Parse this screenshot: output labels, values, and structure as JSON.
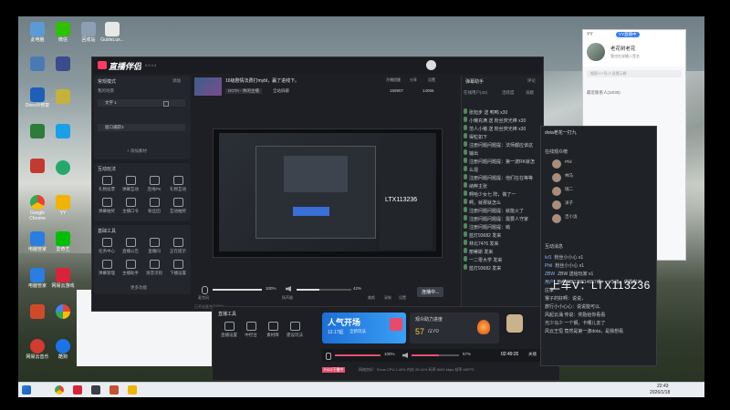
{
  "desktop": {
    "icons_left": [
      {
        "label": "此电脑",
        "color": "#5b9bd5"
      },
      {
        "label": "微信",
        "color": "#2dc100"
      },
      {
        "label": "回收站",
        "color": "#8da0b3"
      },
      {
        "label": "",
        "color": "#4a7ab5"
      },
      {
        "label": "",
        "color": "#3a8ad8"
      },
      {
        "label": "DirectX修复",
        "color": "#1f5fb8"
      },
      {
        "label": "",
        "color": "#2c7c3a"
      },
      {
        "label": "",
        "color": "#c23b2e"
      },
      {
        "label": "Google Chrome",
        "color": "#e94235"
      },
      {
        "label": "电脑管家",
        "color": "#2a7de1"
      },
      {
        "label": "电脑管家",
        "color": "#2a7de1"
      },
      {
        "label": "",
        "color": "#d04a2a"
      },
      {
        "label": "网易云音乐",
        "color": "#d33a31"
      }
    ],
    "icons_col2": [
      {
        "label": "网易UU",
        "color": "#3a3a3a"
      },
      {
        "label": "",
        "color": "#3d4a8b"
      },
      {
        "label": "",
        "color": "#c4b23a"
      },
      {
        "label": "",
        "color": "#19a0e6"
      },
      {
        "label": "YY",
        "color": "#f0b400"
      },
      {
        "label": "爱奇艺",
        "color": "#00be06"
      },
      {
        "label": "网易云游戏",
        "color": "#d8243a"
      },
      {
        "label": "",
        "color": "#4a6ec8"
      },
      {
        "label": "酷狗",
        "color": "#1a73e8"
      }
    ],
    "top_icons": [
      {
        "label": "回收站"
      },
      {
        "label": "GuideLux..."
      }
    ]
  },
  "app": {
    "title": "直播伴侣",
    "version": "6.5.3.4",
    "header_stream_title": "16级剧情法费打mybl，赢了进线下。",
    "header_tag_game": "DOTA - 休闲主播",
    "header_tag_settings": "全站屏蔽",
    "header_right": {
      "online": "开播提醒",
      "rank": "分享",
      "setting": "设置",
      "fans": "159907",
      "likes": "14066"
    },
    "scenes": {
      "header": "常规模式",
      "sub": "我的场景",
      "add": "添加",
      "items": [
        {
          "label": "文字 1"
        },
        {
          "label": "窗口捕获3"
        }
      ],
      "add_material": "+ 添加素材"
    },
    "interact": {
      "header": "互动玩法",
      "items": [
        "礼物投票",
        "弹幕互动",
        "连线PK",
        "礼物互动",
        "弹幕抽奖",
        "主播口令",
        "粉丝团",
        "互动抽奖"
      ]
    },
    "basic": {
      "header": "基础工具",
      "items": [
        "任务中心",
        "直播公告",
        "直播间",
        "正在提示",
        "弹幕管理",
        "主播助手",
        "语音识别",
        "下播设置"
      ]
    },
    "more": "更多功能",
    "bottom_bar": {
      "mic_label": "麦克风",
      "mic_pct": "100%",
      "speaker_label": "扬声器",
      "speaker_pct": "42%",
      "beauty": "美颜",
      "record": "录制",
      "settings": "设置",
      "live_button": "连播中..."
    },
    "status": "已开启麦克风保护..."
  },
  "danmu": {
    "title": "弹幕助手",
    "tabs": [
      "在线用户(42)",
      "活跃度",
      "贡献"
    ],
    "header_right": "评论",
    "sections": [
      {
        "label": "张旭步 送 鸭鸭 x30"
      },
      {
        "label": "小懒充满 送 粉丝荧光棒 x30"
      },
      {
        "label": "范人小猪 送 粉丝荧光棒 x30"
      },
      {
        "label": "得粒如下"
      },
      {
        "label": "注册问题问题提：法师都应该这"
      },
      {
        "label": "输出"
      },
      {
        "label": "注册问题问题提：第一波RK就怎"
      },
      {
        "label": "么混"
      },
      {
        "label": "注册问题问题提：他们在在等等"
      },
      {
        "label": "纳粹主张"
      },
      {
        "label": "啊哈少女七 阵，做了一"
      },
      {
        "label": "啊，就那就怎么"
      },
      {
        "label": "注册问题问题提：就能火了"
      },
      {
        "label": "注册问题问题提：需要人守家"
      },
      {
        "label": "注册问题问题提：呦"
      },
      {
        "label": "蓝灯93682 发来"
      },
      {
        "label": "林北7476 发来"
      },
      {
        "label": "丽蒂斯 发来"
      },
      {
        "label": "一二零大学 发来"
      },
      {
        "label": "蓝灯93682 发来"
      }
    ]
  },
  "bottom_tools": {
    "title": "直播工具",
    "items": [
      "直播设置",
      "中控台",
      "素材库",
      "建设玩法"
    ],
    "promo": {
      "title": "人气开场",
      "date": "12.17起",
      "sub": "全新玩法"
    },
    "progress": {
      "label": "观众助力进度",
      "value": "57",
      "total": "/270"
    },
    "mic_pct": "100%",
    "spk_pct": "57%",
    "time": "02:49:20",
    "end": "关播",
    "status": "网络良好：51ms  CPU 1.40%  内存 25.41%  码率 8000 kbps  帧率 60FPS",
    "status_title": "P413下播中"
  },
  "yy_window": {
    "logo": "YY",
    "tag": "YY直播中",
    "username": "老花树老花",
    "signature": "我也在说输入签名",
    "search": "搜索/YY号/人员提示群",
    "recent": "最近联系人(10/30)"
  },
  "stream_chat": {
    "title": "dota老花一打九",
    "online_header": "在线观众榜",
    "users": [
      {
        "name": "Phil"
      },
      {
        "name": "林马"
      },
      {
        "name": "瑞二"
      },
      {
        "name": "洋子"
      },
      {
        "name": "吉小泷"
      }
    ],
    "interact_header": "互动消息",
    "messages": [
      {
        "user": "lvl1",
        "text": "粉丝小小心 x1"
      },
      {
        "user": "Phil",
        "text": "粉丝小小心 x1"
      },
      {
        "user": "ZBW",
        "text": "ZBW 送给玩家 x1"
      },
      {
        "user": "用户",
        "text": "用户2Z5123814657说：一下诶，优胜啦不"
      },
      {
        "user": "",
        "text": "庄家"
      },
      {
        "user": "",
        "text": "猴子的好啊：说说，"
      },
      {
        "user": "",
        "text": "旅行小小心心：说说能可以."
      },
      {
        "user": "",
        "text": "风起云涌 传说：奖励给你看看"
      },
      {
        "user": "",
        "text": "光少马少 一个钢，卡哪儿去了"
      },
      {
        "user": "",
        "text": "风云王恒 竟然是第一波dota，是我想看"
      }
    ],
    "overlay_text": "上车V：LTX113236"
  },
  "taskbar": {
    "time": "22:43",
    "date": "2026/1/18"
  },
  "preview_overlay": "LTX113236"
}
